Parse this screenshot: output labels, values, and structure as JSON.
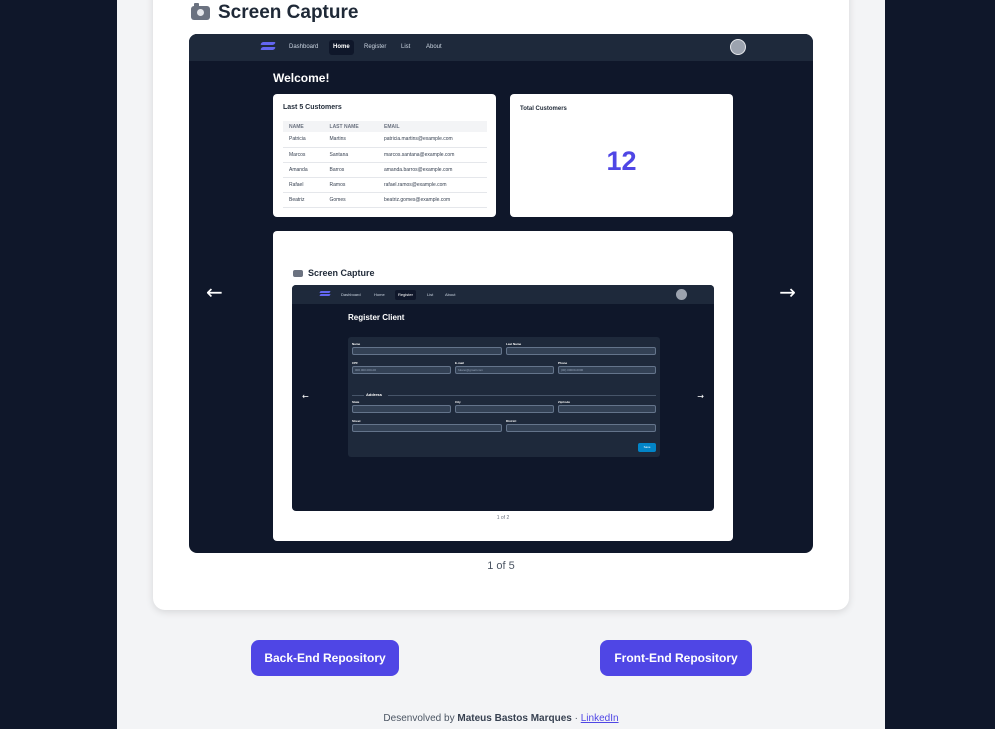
{
  "section": {
    "title": "Screen Capture",
    "icon": "camera-icon"
  },
  "carousel": {
    "prev": "←",
    "next": "→",
    "counter": "1 of 5"
  },
  "app": {
    "nav": [
      "Dashboard",
      "Home",
      "Register",
      "List",
      "About"
    ],
    "active_nav": "Home",
    "welcome": "Welcome!",
    "customers": {
      "title": "Last 5 Customers",
      "headers": [
        "NAME",
        "LAST NAME",
        "EMAIL"
      ],
      "rows": [
        [
          "Patricia",
          "Martins",
          "patricia.martins@example.com"
        ],
        [
          "Marcos",
          "Santana",
          "marcos.santana@example.com"
        ],
        [
          "Amanda",
          "Barros",
          "amanda.barros@example.com"
        ],
        [
          "Rafael",
          "Ramos",
          "rafael.ramos@example.com"
        ],
        [
          "Beatriz",
          "Gomes",
          "beatriz.gomes@example.com"
        ]
      ]
    },
    "total": {
      "title": "Total Customers",
      "value": "12"
    },
    "inner_capture": {
      "title": "Screen Capture",
      "nav": [
        "Dashboard",
        "Home",
        "Register",
        "List",
        "About"
      ],
      "active_nav": "Register",
      "heading": "Register Client",
      "prev": "←",
      "next": "→",
      "form": {
        "name": "Name",
        "last_name": "Last Name",
        "cpf": "CPF",
        "cpf_placeholder": "000.000.000-00",
        "email": "E-mail",
        "email_placeholder": "fulano@gmail.com",
        "phone": "Phone",
        "phone_placeholder": "(00) 00000-0000",
        "address": "Address",
        "state": "State",
        "city": "City",
        "zip": "ZipCode",
        "street": "Street",
        "district": "District",
        "save": "Save"
      },
      "counter": "1 of 2"
    }
  },
  "buttons": {
    "back_end": "Back-End Repository",
    "front_end": "Front-End Repository"
  },
  "footer": {
    "prefix": "Desenvolved by",
    "author": "Mateus Bastos Marques",
    "separator": "·",
    "link": "LinkedIn"
  }
}
